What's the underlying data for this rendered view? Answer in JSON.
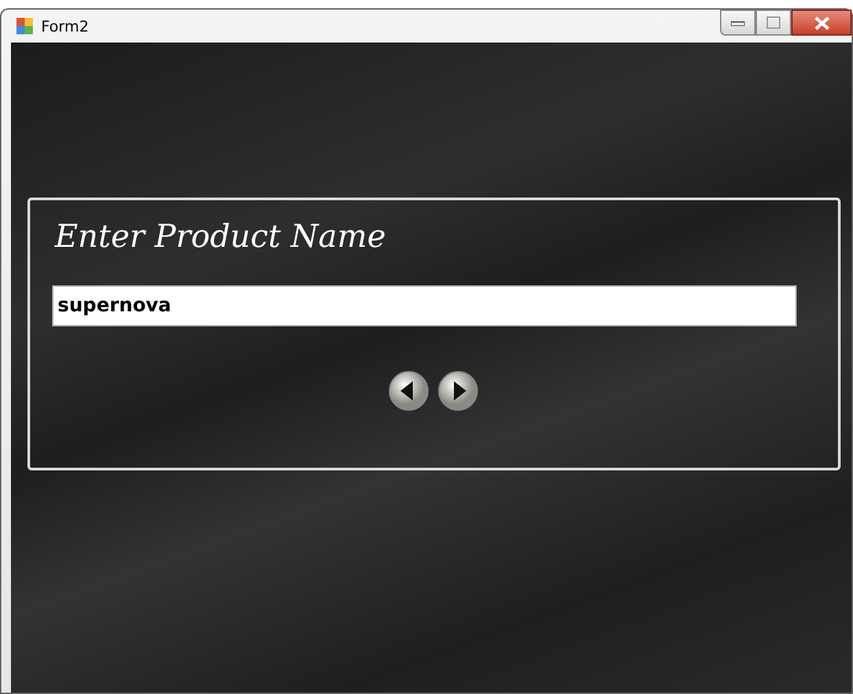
{
  "window": {
    "title": "Form2"
  },
  "panel": {
    "heading": "Enter Product Name",
    "product_name": "supernova"
  }
}
